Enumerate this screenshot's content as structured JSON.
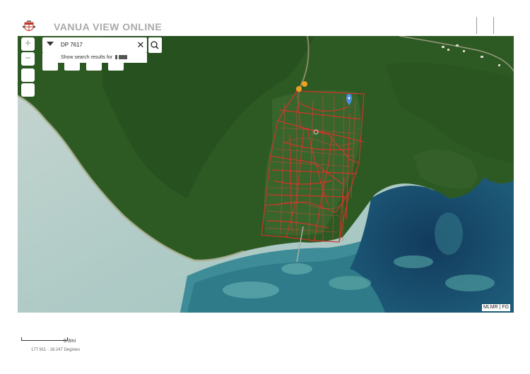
{
  "header": {
    "title": "VANUA VIEW ONLINE",
    "logo_icon": "fiji-coat-of-arms-icon"
  },
  "map": {
    "zoom_in_label": "+",
    "zoom_out_label": "−",
    "attribution": "MLMR | FG",
    "plot_outline_color": "#d8322a",
    "selected_marker_color": "#4a90e2",
    "point_marker_color": "#f0a020"
  },
  "search": {
    "value": "DP 7617",
    "suggestion": "Show search results for",
    "clear_icon": "close-icon",
    "search_icon": "search-icon"
  },
  "scale": {
    "label": "0.3mi",
    "coordinates": "177.911 - 18.247 Degrees"
  }
}
